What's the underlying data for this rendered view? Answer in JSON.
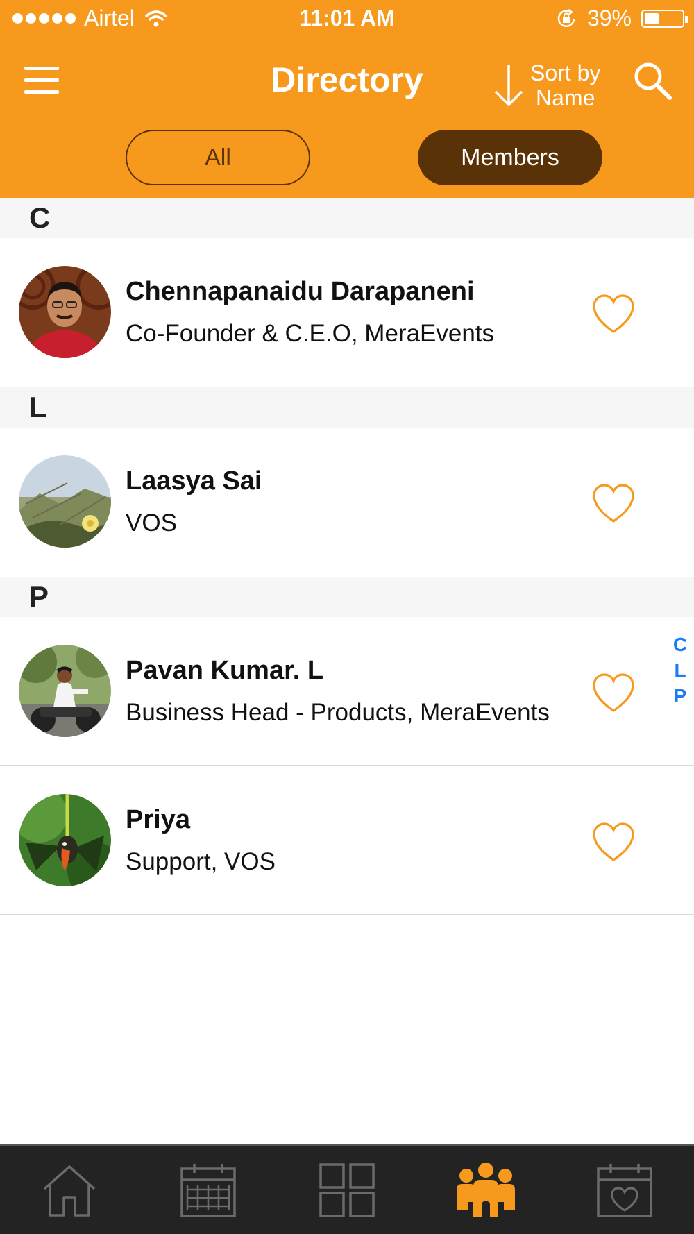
{
  "status_bar": {
    "carrier": "Airtel",
    "time": "11:01 AM",
    "battery": "39%",
    "battery_level": 0.39
  },
  "nav": {
    "title": "Directory",
    "sort_line1": "Sort by",
    "sort_line2": "Name",
    "menu_icon": "hamburger-icon",
    "search_icon": "search-icon"
  },
  "filters": {
    "all": "All",
    "members": "Members",
    "selected": "Members"
  },
  "sections": [
    {
      "letter": "C",
      "members": [
        {
          "name": "Chennapanaidu Darapaneni",
          "role": "Co-Founder & C.E.O, MeraEvents"
        }
      ]
    },
    {
      "letter": "L",
      "members": [
        {
          "name": "Laasya Sai",
          "role": "VOS"
        }
      ]
    },
    {
      "letter": "P",
      "members": [
        {
          "name": "Pavan Kumar. L",
          "role": "Business Head - Products, MeraEvents"
        },
        {
          "name": "Priya",
          "role": "Support, VOS"
        }
      ]
    }
  ],
  "index": [
    "C",
    "L",
    "P"
  ],
  "tabs": [
    "home-icon",
    "calendar-icon",
    "grid-icon",
    "people-icon",
    "calendar-heart-icon"
  ],
  "active_tab": "people-icon",
  "colors": {
    "header": "#f7991c",
    "dark_brown": "#5a3207",
    "accent": "#f7991c",
    "index": "#1a7cf5",
    "tab_bg": "#232323"
  }
}
